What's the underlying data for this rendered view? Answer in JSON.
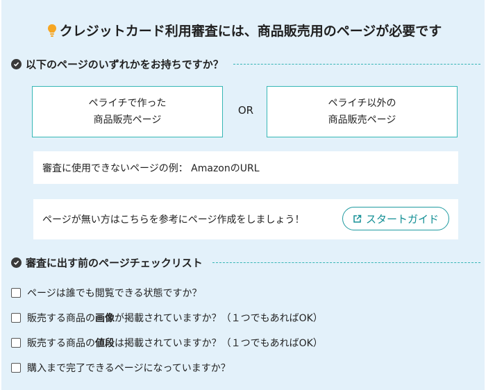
{
  "title": "クレジットカード利用審査には、商品販売用のページが必要です",
  "section1": {
    "heading": "以下のページのいずれかをお持ちですか？",
    "option_a": [
      "ペライチで作った",
      "商品販売ページ"
    ],
    "or_label": "OR",
    "option_b": [
      "ペライチ以外の",
      "商品販売ページ"
    ],
    "unusable_example": "審査に使用できないページの例： AmazonのURL",
    "no_page_text": "ページが無い方はこちらを参考にページ作成をしましょう！",
    "guide_button": "スタートガイド"
  },
  "section2": {
    "heading": "審査に出す前のページチェックリスト",
    "items": [
      {
        "before": "ページは誰でも閲覧できる状態ですか？",
        "bold": "",
        "after": "",
        "checked": false
      },
      {
        "before": "販売する商品の",
        "bold": "画像",
        "after": "が掲載されていますか？（１つでもあればOK）",
        "checked": false
      },
      {
        "before": "販売する商品の",
        "bold": "値段",
        "after": "は掲載されていますか？（１つでもあればOK）",
        "checked": false
      },
      {
        "before": "購入まで完了できるページになっていますか？",
        "bold": "",
        "after": "",
        "checked": false
      }
    ]
  },
  "colors": {
    "panel_bg": "#e3f1fa",
    "accent": "#35b7b5",
    "button_text": "#138f95",
    "bulb": "#f6a623"
  },
  "icons": [
    "lightbulb-icon",
    "check-circle-icon",
    "external-link-icon",
    "checkbox"
  ]
}
